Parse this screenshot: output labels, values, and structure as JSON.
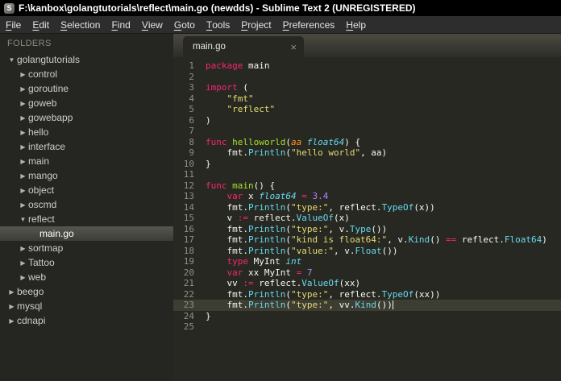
{
  "window": {
    "title": "F:\\kanbox\\golangtutorials\\reflect\\main.go (newdds) - Sublime Text 2 (UNREGISTERED)",
    "app_icon_glyph": "S"
  },
  "menu": {
    "items": [
      "File",
      "Edit",
      "Selection",
      "Find",
      "View",
      "Goto",
      "Tools",
      "Project",
      "Preferences",
      "Help"
    ]
  },
  "sidebar": {
    "header": "FOLDERS",
    "items": [
      {
        "label": "golangtutorials",
        "level": 0,
        "type": "folder",
        "expanded": true
      },
      {
        "label": "control",
        "level": 1,
        "type": "folder",
        "expanded": false
      },
      {
        "label": "goroutine",
        "level": 1,
        "type": "folder",
        "expanded": false
      },
      {
        "label": "goweb",
        "level": 1,
        "type": "folder",
        "expanded": false
      },
      {
        "label": "gowebapp",
        "level": 1,
        "type": "folder",
        "expanded": false
      },
      {
        "label": "hello",
        "level": 1,
        "type": "folder",
        "expanded": false
      },
      {
        "label": "interface",
        "level": 1,
        "type": "folder",
        "expanded": false
      },
      {
        "label": "main",
        "level": 1,
        "type": "folder",
        "expanded": false
      },
      {
        "label": "mango",
        "level": 1,
        "type": "folder",
        "expanded": false
      },
      {
        "label": "object",
        "level": 1,
        "type": "folder",
        "expanded": false
      },
      {
        "label": "oscmd",
        "level": 1,
        "type": "folder",
        "expanded": false
      },
      {
        "label": "reflect",
        "level": 1,
        "type": "folder",
        "expanded": true
      },
      {
        "label": "main.go",
        "level": 2,
        "type": "file",
        "selected": true
      },
      {
        "label": "sortmap",
        "level": 1,
        "type": "folder",
        "expanded": false
      },
      {
        "label": "Tattoo",
        "level": 1,
        "type": "folder",
        "expanded": false
      },
      {
        "label": "web",
        "level": 1,
        "type": "folder",
        "expanded": false
      },
      {
        "label": "beego",
        "level": 0,
        "type": "folder",
        "expanded": false
      },
      {
        "label": "mysql",
        "level": 0,
        "type": "folder",
        "expanded": false
      },
      {
        "label": "cdnapi",
        "level": 0,
        "type": "folder",
        "expanded": false
      }
    ]
  },
  "editor": {
    "tab": {
      "label": "main.go",
      "close_icon": "×"
    },
    "lines": [
      {
        "num": 1,
        "segs": [
          [
            "k",
            "package"
          ],
          [
            "p",
            " main"
          ]
        ]
      },
      {
        "num": 2,
        "segs": []
      },
      {
        "num": 3,
        "segs": [
          [
            "k",
            "import"
          ],
          [
            "p",
            " ("
          ]
        ]
      },
      {
        "num": 4,
        "segs": [
          [
            "p",
            "    "
          ],
          [
            "s",
            "\"fmt\""
          ]
        ]
      },
      {
        "num": 5,
        "segs": [
          [
            "p",
            "    "
          ],
          [
            "s",
            "\"reflect\""
          ]
        ]
      },
      {
        "num": 6,
        "segs": [
          [
            "p",
            ")"
          ]
        ]
      },
      {
        "num": 7,
        "segs": []
      },
      {
        "num": 8,
        "segs": [
          [
            "k",
            "func"
          ],
          [
            "p",
            " "
          ],
          [
            "g",
            "helloworld"
          ],
          [
            "p",
            "("
          ],
          [
            "o",
            "aa"
          ],
          [
            "p",
            " "
          ],
          [
            "ci",
            "float64"
          ],
          [
            "p",
            ") {"
          ]
        ]
      },
      {
        "num": 9,
        "segs": [
          [
            "p",
            "    fmt."
          ],
          [
            "c",
            "Println"
          ],
          [
            "p",
            "("
          ],
          [
            "s",
            "\"hello world\""
          ],
          [
            "p",
            ", aa)"
          ]
        ]
      },
      {
        "num": 10,
        "segs": [
          [
            "p",
            "}"
          ]
        ]
      },
      {
        "num": 11,
        "segs": []
      },
      {
        "num": 12,
        "segs": [
          [
            "k",
            "func"
          ],
          [
            "p",
            " "
          ],
          [
            "g",
            "main"
          ],
          [
            "p",
            "() {"
          ]
        ]
      },
      {
        "num": 13,
        "segs": [
          [
            "p",
            "    "
          ],
          [
            "k",
            "var"
          ],
          [
            "p",
            " x "
          ],
          [
            "ci",
            "float64"
          ],
          [
            "p",
            " "
          ],
          [
            "k",
            "="
          ],
          [
            "p",
            " "
          ],
          [
            "n",
            "3.4"
          ]
        ]
      },
      {
        "num": 14,
        "segs": [
          [
            "p",
            "    fmt."
          ],
          [
            "c",
            "Println"
          ],
          [
            "p",
            "("
          ],
          [
            "s",
            "\"type:\""
          ],
          [
            "p",
            ", reflect."
          ],
          [
            "c",
            "TypeOf"
          ],
          [
            "p",
            "(x))"
          ]
        ]
      },
      {
        "num": 15,
        "segs": [
          [
            "p",
            "    v "
          ],
          [
            "k",
            ":="
          ],
          [
            "p",
            " reflect."
          ],
          [
            "c",
            "ValueOf"
          ],
          [
            "p",
            "(x)"
          ]
        ]
      },
      {
        "num": 16,
        "segs": [
          [
            "p",
            "    fmt."
          ],
          [
            "c",
            "Println"
          ],
          [
            "p",
            "("
          ],
          [
            "s",
            "\"type:\""
          ],
          [
            "p",
            ", v."
          ],
          [
            "c",
            "Type"
          ],
          [
            "p",
            "())"
          ]
        ]
      },
      {
        "num": 17,
        "segs": [
          [
            "p",
            "    fmt."
          ],
          [
            "c",
            "Println"
          ],
          [
            "p",
            "("
          ],
          [
            "s",
            "\"kind is float64:\""
          ],
          [
            "p",
            ", v."
          ],
          [
            "c",
            "Kind"
          ],
          [
            "p",
            "() "
          ],
          [
            "k",
            "=="
          ],
          [
            "p",
            " reflect."
          ],
          [
            "c",
            "Float64"
          ],
          [
            "p",
            ")"
          ]
        ]
      },
      {
        "num": 18,
        "segs": [
          [
            "p",
            "    fmt."
          ],
          [
            "c",
            "Println"
          ],
          [
            "p",
            "("
          ],
          [
            "s",
            "\"value:\""
          ],
          [
            "p",
            ", v."
          ],
          [
            "c",
            "Float"
          ],
          [
            "p",
            "())"
          ]
        ]
      },
      {
        "num": 19,
        "segs": [
          [
            "p",
            "    "
          ],
          [
            "k",
            "type"
          ],
          [
            "p",
            " MyInt "
          ],
          [
            "ci",
            "int"
          ]
        ]
      },
      {
        "num": 20,
        "segs": [
          [
            "p",
            "    "
          ],
          [
            "k",
            "var"
          ],
          [
            "p",
            " xx MyInt "
          ],
          [
            "k",
            "="
          ],
          [
            "p",
            " "
          ],
          [
            "n",
            "7"
          ]
        ]
      },
      {
        "num": 21,
        "segs": [
          [
            "p",
            "    vv "
          ],
          [
            "k",
            ":="
          ],
          [
            "p",
            " reflect."
          ],
          [
            "c",
            "ValueOf"
          ],
          [
            "p",
            "(xx)"
          ]
        ]
      },
      {
        "num": 22,
        "segs": [
          [
            "p",
            "    fmt."
          ],
          [
            "c",
            "Println"
          ],
          [
            "p",
            "("
          ],
          [
            "s",
            "\"type:\""
          ],
          [
            "p",
            ", reflect."
          ],
          [
            "c",
            "TypeOf"
          ],
          [
            "p",
            "(xx))"
          ]
        ]
      },
      {
        "num": 23,
        "segs": [
          [
            "p",
            "    fmt."
          ],
          [
            "c",
            "Println"
          ],
          [
            "p",
            "("
          ],
          [
            "s",
            "\"type:\""
          ],
          [
            "p",
            ", vv."
          ],
          [
            "c",
            "Kind"
          ],
          [
            "p",
            "())"
          ]
        ],
        "current": true,
        "cursor": true
      },
      {
        "num": 24,
        "segs": [
          [
            "p",
            "}"
          ]
        ]
      },
      {
        "num": 25,
        "segs": []
      }
    ]
  },
  "colors": {
    "editor_bg": "#272822",
    "sidebar_bg": "#252521",
    "titlebar_bg": "#000000",
    "menubar_bg": "#2d2d2d",
    "current_line_bg": "#3e3d32",
    "line_number": "#8f908a",
    "keyword": "#f92672",
    "string": "#e6db74",
    "support_function": "#66d9ef",
    "builtin_type": "#66d9ef",
    "function_name": "#a6e22e",
    "number": "#ae81ff",
    "parameter": "#fd971f",
    "plain_text": "#f8f8f2"
  }
}
